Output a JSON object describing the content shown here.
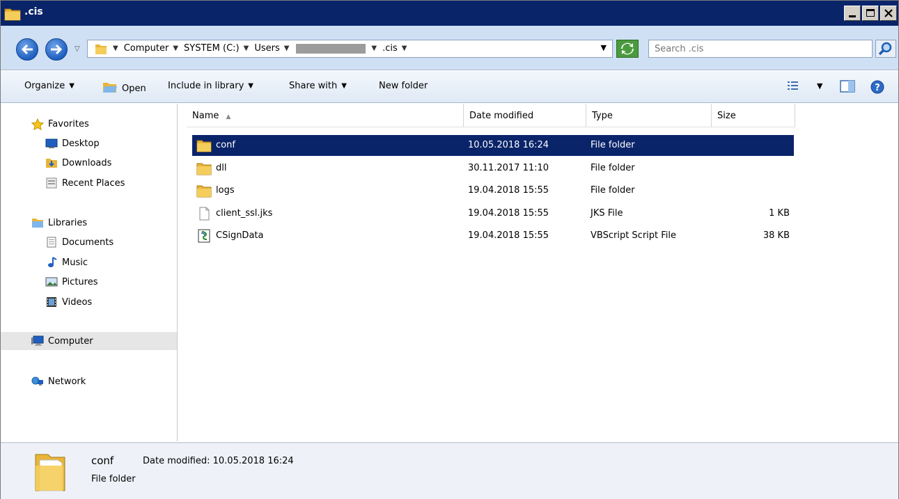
{
  "window": {
    "title": ".cis"
  },
  "address": {
    "crumbs": [
      "Computer",
      "SYSTEM (C:)",
      "Users",
      ".cis"
    ],
    "search_placeholder": "Search .cis"
  },
  "toolbar": {
    "organize": "Organize",
    "open": "Open",
    "include_in_library": "Include in library",
    "share_with": "Share with",
    "new_folder": "New folder"
  },
  "sidebar": {
    "favorites": "Favorites",
    "desktop": "Desktop",
    "downloads": "Downloads",
    "recent_places": "Recent Places",
    "libraries": "Libraries",
    "documents": "Documents",
    "music": "Music",
    "pictures": "Pictures",
    "videos": "Videos",
    "computer": "Computer",
    "network": "Network"
  },
  "columns": {
    "name": "Name",
    "date": "Date modified",
    "type": "Type",
    "size": "Size"
  },
  "files": [
    {
      "name": "conf",
      "date": "10.05.2018 16:24",
      "type": "File folder",
      "size": "",
      "icon": "folder-icon"
    },
    {
      "name": "dll",
      "date": "30.11.2017 11:10",
      "type": "File folder",
      "size": "",
      "icon": "folder-icon"
    },
    {
      "name": "logs",
      "date": "19.04.2018 15:55",
      "type": "File folder",
      "size": "",
      "icon": "folder-icon"
    },
    {
      "name": "client_ssl.jks",
      "date": "19.04.2018 15:55",
      "type": "JKS File",
      "size": "1 KB",
      "icon": "blank-file-icon"
    },
    {
      "name": "CSignData",
      "date": "19.04.2018 15:55",
      "type": "VBScript Script File",
      "size": "38 KB",
      "icon": "vbscript-icon"
    }
  ],
  "details": {
    "name": "conf",
    "modified": "Date modified: 10.05.2018 16:24",
    "type": "File folder"
  },
  "colors": {
    "selection": "#0a246a",
    "titlebar": "#0a246a",
    "address_bg": "#cfe0f5"
  }
}
